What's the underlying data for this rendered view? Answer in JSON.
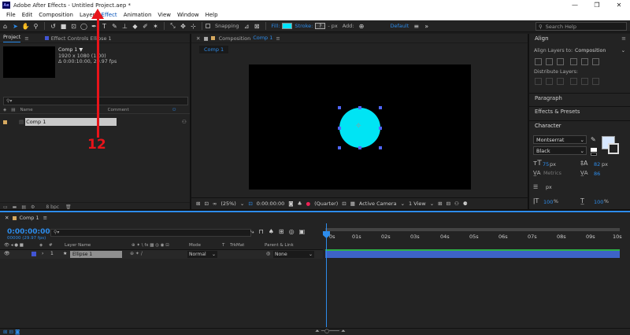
{
  "window": {
    "app_logo": "Ae",
    "title": "Adobe After Effects - Untitled Project.aep *",
    "minimize": "—",
    "maximize": "❐",
    "close": "✕"
  },
  "menu": [
    "File",
    "Edit",
    "Composition",
    "Layer",
    "Effect",
    "Animation",
    "View",
    "Window",
    "Help"
  ],
  "toolbar": {
    "snapping_label": "Snapping",
    "fill_label": "Fill:",
    "fill_color": "#00e5ff",
    "stroke_label": "Stroke:",
    "stroke_value": "?",
    "stroke_width": "- px",
    "add_label": "Add:",
    "workspace": "Default",
    "search_placeholder": "Search Help"
  },
  "project_panel": {
    "tab_project": "Project",
    "tab_effect_controls": "Effect Controls Ellipse 1",
    "comp_name": "Comp 1 ▼",
    "comp_size": "1920 x 1080 (1.00)",
    "comp_duration": "Δ 0:00:10:00, 29.97 fps",
    "col_name": "Name",
    "col_comment": "Comment",
    "item_name": "Comp 1",
    "bpc": "8 bpc"
  },
  "composition_panel": {
    "tab_label": "Composition",
    "tab_comp": "Comp 1",
    "sub_tab": "Comp 1",
    "shape_color": "#00e4f4",
    "zoom": "(25%)",
    "timecode": "0:00:00:00",
    "resolution": "(Quarter)",
    "camera": "Active Camera",
    "views": "1 View"
  },
  "right_panels": {
    "align_title": "Align",
    "align_to_label": "Align Layers to:",
    "align_to_value": "Composition",
    "distribute_label": "Distribute Layers:",
    "paragraph": "Paragraph",
    "effects_presets": "Effects & Presets",
    "character": "Character",
    "font_family": "Montserrat",
    "font_style": "Black",
    "font_size": "75",
    "font_size_unit": "px",
    "leading": "82",
    "leading_unit": "px",
    "kerning": "Metrics",
    "tracking": "86",
    "stroke_px": "px",
    "vscale": "100",
    "hscale": "100",
    "percent": "%"
  },
  "timeline": {
    "tab_comp": "Comp 1",
    "timecode": "0:00:00:00",
    "fps": "00000 (29.97 fps)",
    "col_layer_name": "Layer Name",
    "col_mode": "Mode",
    "col_t": "T",
    "col_trkmat": "TrkMat",
    "col_parent": "Parent & Link",
    "layer_number": "1",
    "layer_name": "Ellipse 1",
    "layer_mode": "Normal",
    "layer_parent": "None",
    "ruler_ticks": [
      "0s",
      "01s",
      "02s",
      "03s",
      "04s",
      "05s",
      "06s",
      "07s",
      "08s",
      "09s",
      "10s"
    ]
  },
  "annotation": {
    "label": "12",
    "color": "#e8141a"
  }
}
